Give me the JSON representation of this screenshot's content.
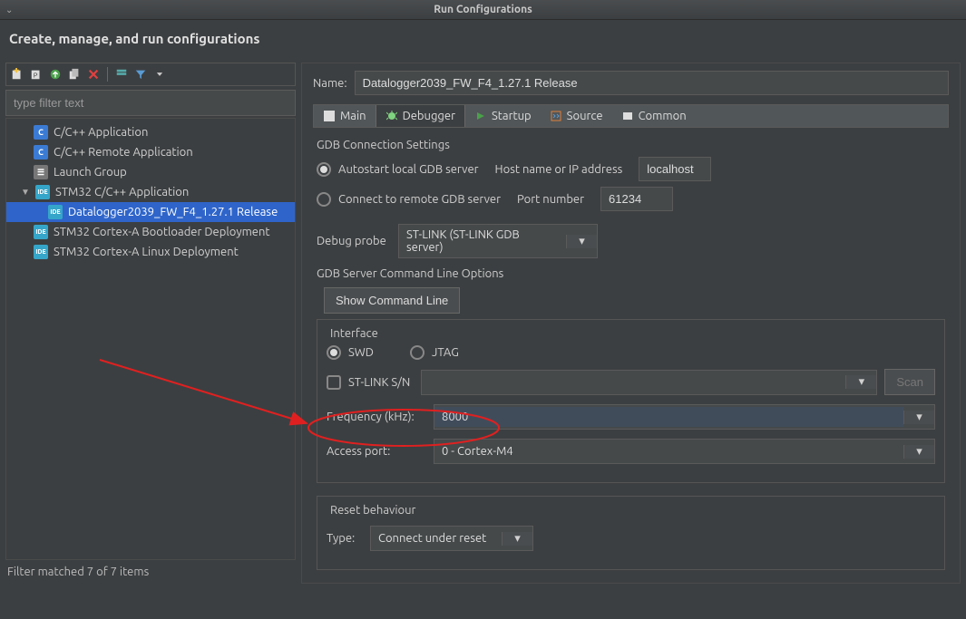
{
  "window": {
    "title": "Run Configurations"
  },
  "header": {
    "title": "Create, manage, and run configurations"
  },
  "filter": {
    "placeholder": "type filter text",
    "status": "Filter matched 7 of 7 items"
  },
  "tree": {
    "items": [
      {
        "label": "C/C++ Application",
        "icon": "c"
      },
      {
        "label": "C/C++ Remote Application",
        "icon": "c"
      },
      {
        "label": "Launch Group",
        "icon": "grp"
      },
      {
        "label": "STM32 C/C++ Application",
        "icon": "ide",
        "expanded": true,
        "children": [
          {
            "label": "Datalogger2039_FW_F4_1.27.1 Release",
            "icon": "ide",
            "selected": true
          }
        ]
      },
      {
        "label": "STM32 Cortex-A Bootloader Deployment",
        "icon": "ide"
      },
      {
        "label": "STM32 Cortex-A Linux Deployment",
        "icon": "ide"
      }
    ]
  },
  "config": {
    "name_label": "Name:",
    "name_value": "Datalogger2039_FW_F4_1.27.1 Release",
    "tabs": {
      "main": "Main",
      "debugger": "Debugger",
      "startup": "Startup",
      "source": "Source",
      "common": "Common"
    },
    "gdb": {
      "section": "GDB Connection Settings",
      "autostart": "Autostart local GDB server",
      "connect_remote": "Connect to remote GDB server",
      "host_label": "Host name or IP address",
      "host_value": "localhost",
      "port_label": "Port number",
      "port_value": "61234"
    },
    "debug_probe": {
      "label": "Debug probe",
      "value": "ST-LINK (ST-LINK GDB server)"
    },
    "server_opts": {
      "section": "GDB Server Command Line Options",
      "show_cmd": "Show Command Line",
      "interface": {
        "legend": "Interface",
        "swd": "SWD",
        "jtag": "JTAG",
        "stlink_sn": "ST-LINK S/N",
        "sn_value": "",
        "scan": "Scan",
        "freq_label": "Frequency (kHz):",
        "freq_value": "8000",
        "access_port_label": "Access port:",
        "access_port_value": "0 - Cortex-M4"
      },
      "reset": {
        "legend": "Reset behaviour",
        "type_label": "Type:",
        "type_value": "Connect under reset"
      }
    }
  }
}
